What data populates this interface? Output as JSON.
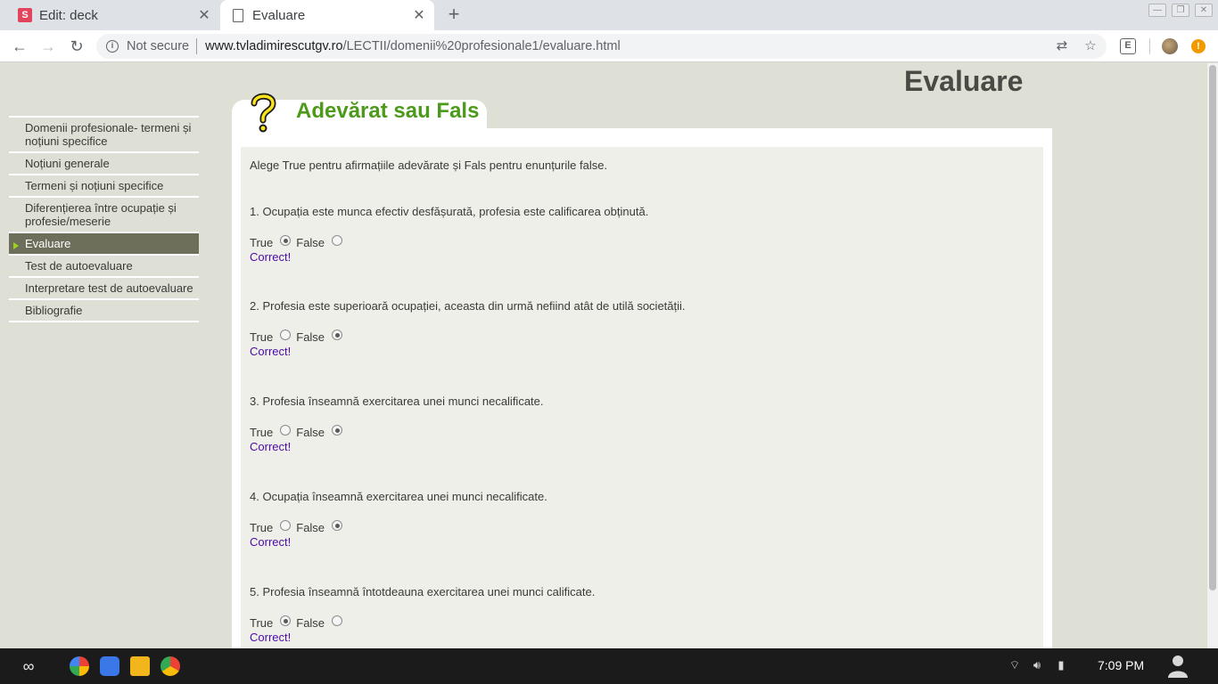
{
  "browser": {
    "tabs": [
      {
        "title": "Edit: deck",
        "favicon": "s-icon",
        "active": false
      },
      {
        "title": "Evaluare",
        "favicon": "document-icon",
        "active": true
      }
    ],
    "url_security": "Not secure",
    "url_host": "www.tvladimirescutgv.ro",
    "url_path": "/LECTII/domenii%20profesionale1/evaluare.html",
    "extension_label": "E"
  },
  "page": {
    "title": "Evaluare",
    "section_title": "Adevărat sau Fals",
    "instructions": "Alege True pentru afirmațiile adevărate și Fals pentru enunțurile false.",
    "sidebar": [
      {
        "label": "Domenii profesionale- termeni și noțiuni specifice",
        "selected": false
      },
      {
        "label": "Noțiuni generale",
        "selected": false
      },
      {
        "label": "Termeni și noțiuni specifice",
        "selected": false
      },
      {
        "label": "Diferențierea între ocupație și profesie/meserie",
        "selected": false
      },
      {
        "label": "Evaluare",
        "selected": true
      },
      {
        "label": "Test de autoevaluare",
        "selected": false
      },
      {
        "label": "Interpretare test de autoevaluare",
        "selected": false
      },
      {
        "label": "Bibliografie",
        "selected": false
      }
    ],
    "questions": [
      {
        "text": "1. Ocupația este munca efectiv desfășurată, profesia este calificarea obținută.",
        "true_label": "True",
        "false_label": "False",
        "selected": "true",
        "result": "Correct!"
      },
      {
        "text": "2. Profesia este superioară ocupației, aceasta din urmă nefiind atât de utilă societății.",
        "true_label": "True",
        "false_label": "False",
        "selected": "false",
        "result": "Correct!"
      },
      {
        "text": "3. Profesia înseamnă exercitarea unei munci necalificate.",
        "true_label": "True",
        "false_label": "False",
        "selected": "false",
        "result": "Correct!"
      },
      {
        "text": "4. Ocupația înseamnă exercitarea unei munci necalificate.",
        "true_label": "True",
        "false_label": "False",
        "selected": "false",
        "result": "Correct!"
      },
      {
        "text": "5. Profesia înseamnă întotdeauna exercitarea unei munci calificate.",
        "true_label": "True",
        "false_label": "False",
        "selected": "true",
        "result": "Correct!"
      }
    ]
  },
  "shelf": {
    "clock": "7:09 PM"
  },
  "colors": {
    "section_title": "#4c9a1a",
    "result": "#4b0aa8",
    "selected_nav": "#6d6f5b",
    "page_bg": "#dedfd5"
  }
}
